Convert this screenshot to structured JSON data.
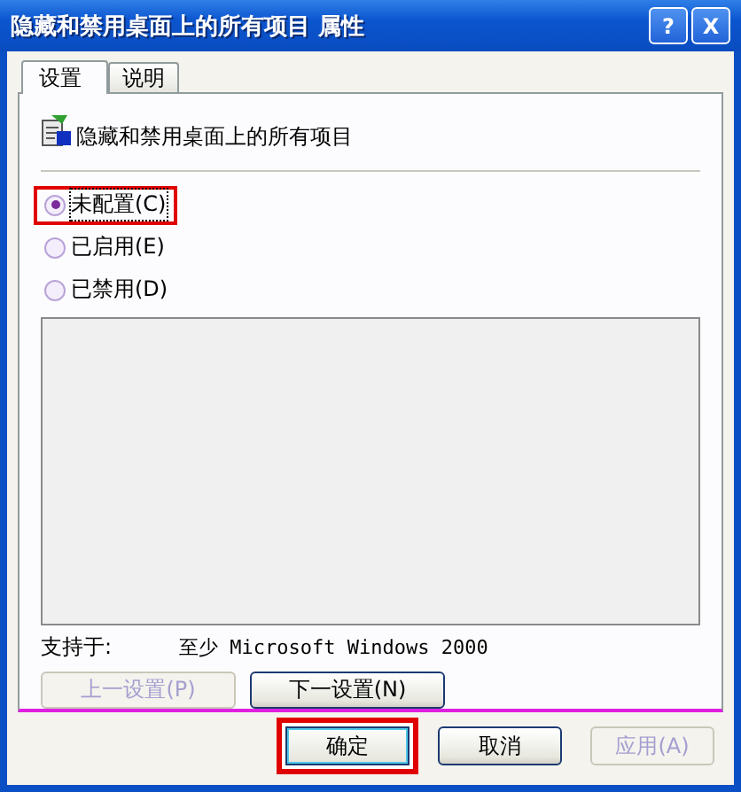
{
  "window": {
    "title": "隐藏和禁用桌面上的所有项目 属性",
    "help_glyph": "?",
    "close_glyph": "X"
  },
  "tabs": [
    {
      "label": "设置",
      "selected": true
    },
    {
      "label": "说明",
      "selected": false
    }
  ],
  "policy": {
    "name": "隐藏和禁用桌面上的所有项目"
  },
  "options": [
    {
      "label": "未配置(C)",
      "selected": true,
      "highlighted": true
    },
    {
      "label": "已启用(E)",
      "selected": false,
      "highlighted": false
    },
    {
      "label": "已禁用(D)",
      "selected": false,
      "highlighted": false
    }
  ],
  "supported": {
    "label": "支持于:",
    "value": "至少 Microsoft Windows 2000"
  },
  "nav_buttons": [
    {
      "label": "上一设置(P)",
      "disabled": true
    },
    {
      "label": "下一设置(N)",
      "disabled": false
    }
  ],
  "buttons": [
    {
      "label": "确定",
      "disabled": false,
      "highlighted": true
    },
    {
      "label": "取消",
      "disabled": false,
      "highlighted": false
    },
    {
      "label": "应用(A)",
      "disabled": true,
      "highlighted": false
    }
  ]
}
